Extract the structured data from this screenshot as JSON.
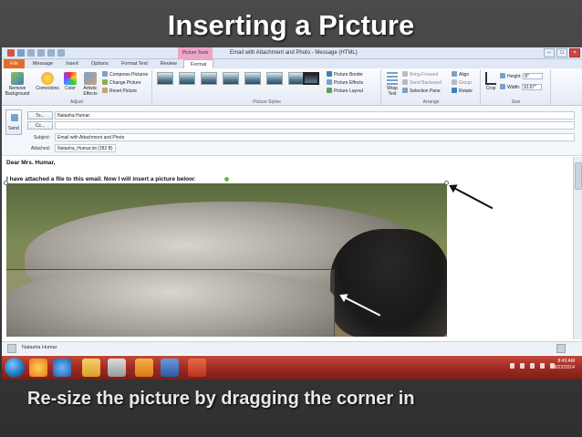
{
  "slide": {
    "title": "Inserting a Picture",
    "caption": "Re-size the picture by dragging the corner in"
  },
  "window": {
    "title": "Email with Attachment and Photo  -  Message (HTML)",
    "contextual_tab": "Picture Tools"
  },
  "tabs": [
    "File",
    "Message",
    "Insert",
    "Options",
    "Format Text",
    "Review",
    "Format"
  ],
  "ribbon": {
    "adjust": {
      "label": "Adjust",
      "remove_background": "Remove Background",
      "corrections": "Corrections",
      "color": "Color",
      "artistic_effects": "Artistic Effects",
      "compress": "Compress Pictures",
      "change": "Change Picture",
      "reset": "Reset Picture"
    },
    "styles": {
      "label": "Picture Styles",
      "border": "Picture Border",
      "effects": "Picture Effects",
      "layout": "Picture Layout"
    },
    "arrange": {
      "label": "Arrange",
      "wrap_text": "Wrap Text",
      "bring_forward": "Bring Forward",
      "send_backward": "Send Backward",
      "selection_pane": "Selection Pane",
      "align": "Align",
      "group": "Group",
      "rotate": "Rotate"
    },
    "size": {
      "label": "Size",
      "crop": "Crop",
      "height_label": "Height:",
      "height_value": "8\"",
      "width_label": "Width:",
      "width_value": "10.67\""
    }
  },
  "header": {
    "send": "Send",
    "to_btn": "To...",
    "to_value": "Natasha Humar;",
    "cc_btn": "Cc...",
    "cc_value": "",
    "subject_label": "Subject:",
    "subject_value": "Email with Attachment and Photo",
    "attached_label": "Attached:",
    "attached_value": "Natasha_Humar.txt (282 B)"
  },
  "body": {
    "greeting": "Dear Mrs. Humar,",
    "line": "I have attached a file to this email. Now I will insert a picture below:"
  },
  "people_pane": {
    "name": "Natasha Humar"
  },
  "clock": {
    "time": "8:49 AM",
    "date": "8/22/2014"
  },
  "colors": {
    "file_tab": "#e26c2b",
    "taskbar": "#a02a22",
    "slide_bg": "#3a3a3a"
  }
}
